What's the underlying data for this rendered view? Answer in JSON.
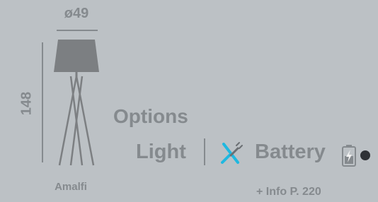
{
  "product": {
    "name": "Amalfi",
    "diameter_label": "ø49",
    "height_label": "148"
  },
  "options": {
    "title": "Options",
    "light_label": "Light",
    "battery_label": "Battery",
    "info_link": "+ Info P. 220"
  },
  "icons": {
    "lamp": "floor-lamp-illustration",
    "unplug": "unplugged-cord-icon",
    "battery": "battery-charging-icon"
  },
  "colors": {
    "background": "#bcc1c5",
    "text": "#858a8e",
    "lamp": "#7c7f82",
    "accent_cyan": "#1fb8e0",
    "color_dot": "#2f3236"
  }
}
